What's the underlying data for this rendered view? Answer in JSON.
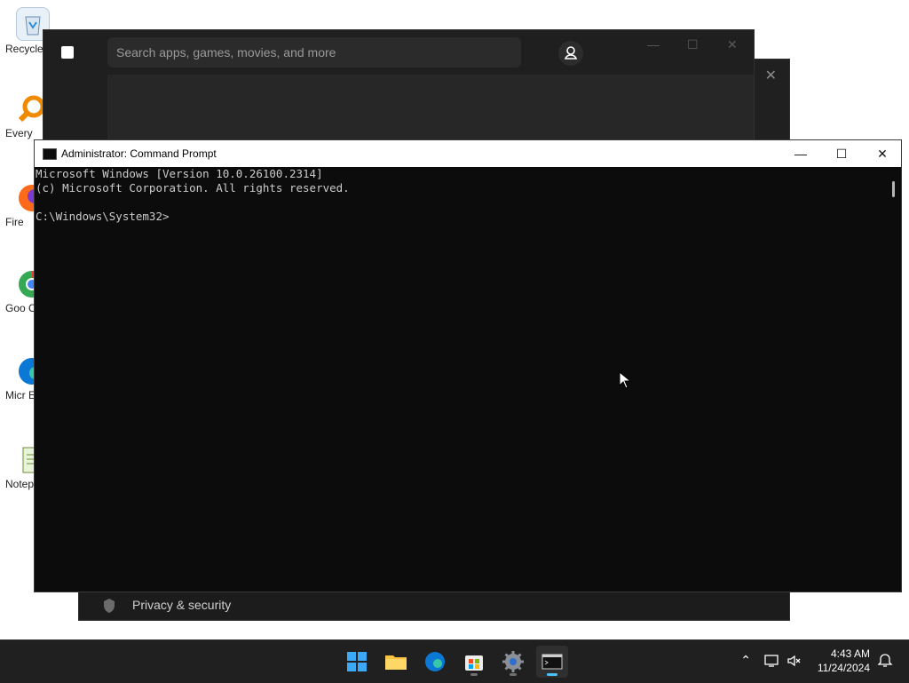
{
  "desktop": {
    "icons": [
      {
        "label": "Recycle",
        "icon": "recycle-bin-icon"
      },
      {
        "label": "Every",
        "icon": "everything-search-icon"
      },
      {
        "label": "Fire",
        "icon": "firefox-icon"
      },
      {
        "label": "Goo Chr",
        "icon": "chrome-icon"
      },
      {
        "label": "Micr Ed",
        "icon": "edge-icon"
      },
      {
        "label": "Notep",
        "icon": "notepad-icon"
      }
    ]
  },
  "store": {
    "search_placeholder": "Search apps, games, movies, and more"
  },
  "settings": {
    "privacy_label": "Privacy & security"
  },
  "cmd": {
    "title": "Administrator: Command Prompt",
    "lines": [
      "Microsoft Windows [Version 10.0.26100.2314]",
      "(c) Microsoft Corporation. All rights reserved.",
      "",
      "C:\\Windows\\System32>"
    ]
  },
  "taskbar": {
    "apps": [
      {
        "name": "start",
        "icon": "windows-start-icon"
      },
      {
        "name": "file-explorer",
        "icon": "folder-icon"
      },
      {
        "name": "edge",
        "icon": "edge-icon"
      },
      {
        "name": "microsoft-store",
        "icon": "store-icon"
      },
      {
        "name": "settings",
        "icon": "gear-icon"
      },
      {
        "name": "command-prompt",
        "icon": "terminal-icon"
      }
    ],
    "time": "4:43 AM",
    "date": "11/24/2024"
  },
  "colors": {
    "accent": "#4cc2ff",
    "cmd_bg": "#0c0c0c",
    "cmd_text": "#cccccc",
    "taskbar_bg": "#202020"
  }
}
